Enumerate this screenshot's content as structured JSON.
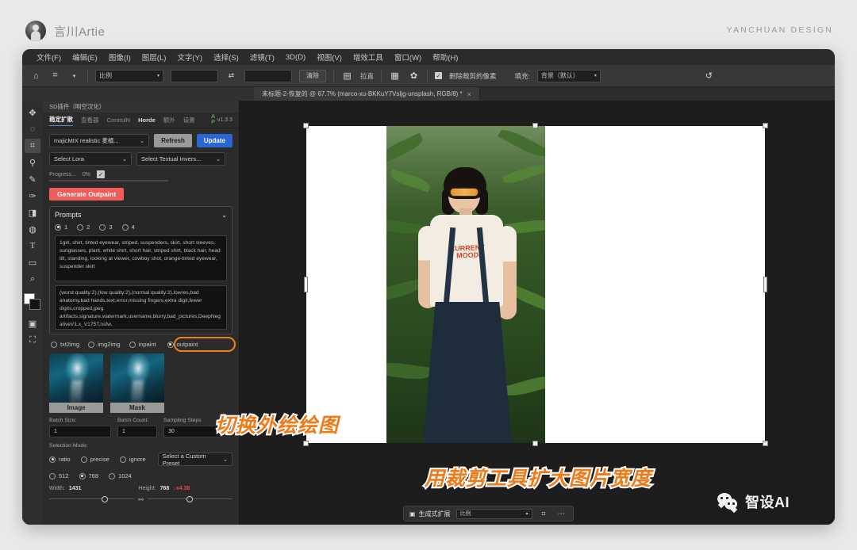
{
  "outer": {
    "author_name": "言川Artie",
    "brand_right": "YANCHUAN DESIGN"
  },
  "menubar": {
    "items": [
      "文件(F)",
      "编辑(E)",
      "图像(I)",
      "图层(L)",
      "文字(Y)",
      "选择(S)",
      "滤镜(T)",
      "3D(D)",
      "视图(V)",
      "增效工具",
      "窗口(W)",
      "帮助(H)"
    ]
  },
  "optionsbar": {
    "home_icon": "home-icon",
    "tool_icon": "crop-tool-icon",
    "ratio_select": "比例",
    "width_value": "",
    "height_value": "",
    "swap_icon": "swap-arrows-icon",
    "clear_button": "清除",
    "straighten_label": "拉直",
    "straighten_icon": "straighten-icon",
    "grid_icon": "grid-overlay-icon",
    "gear_icon": "gear-icon",
    "delete_cropped_label": "删除裁剪的像素",
    "fill_label": "填充:",
    "fill_value": "背景（默认）",
    "reset_icon": "reset-icon"
  },
  "tabstrip": {
    "doc_tab_title": "未标题-2-恢复的 @ 67.7% (marco-xu-BKKuY7Vsljg-unsplash, RGB/8) *",
    "close_icon": "close-icon"
  },
  "tools": {
    "items": [
      {
        "name": "move-tool",
        "glyph": "✥"
      },
      {
        "name": "lasso-tool",
        "glyph": "◯"
      },
      {
        "name": "crop-tool",
        "glyph": "⌗",
        "active": true
      },
      {
        "name": "eyedropper-tool",
        "glyph": "⚲"
      },
      {
        "name": "brush-tool",
        "glyph": "✎"
      },
      {
        "name": "healing-brush-tool",
        "glyph": "✒"
      },
      {
        "name": "paint-bucket-tool",
        "glyph": "◨"
      },
      {
        "name": "dodge-tool",
        "glyph": "⌕"
      },
      {
        "name": "type-tool",
        "glyph": "T"
      },
      {
        "name": "shape-tool",
        "glyph": "▭"
      },
      {
        "name": "zoom-tool",
        "glyph": "🔍"
      }
    ]
  },
  "sdpanel": {
    "title": "SD插件（明空汉化）",
    "tabs": [
      {
        "label": "稳定扩散",
        "active": true
      },
      {
        "label": "查看器",
        "active": false
      },
      {
        "label": "ControlN",
        "active": false
      },
      {
        "label": "Horde",
        "active": false
      },
      {
        "label": "额外",
        "active": false
      },
      {
        "label": "设置",
        "active": false
      }
    ],
    "version": "v1.3.3",
    "model_select": "majicMIX realistic 麦橘...",
    "refresh_button": "Refresh",
    "update_button": "Update",
    "lora_select": "Select Lora",
    "textual_inversion_select": "Select Textual Invers...",
    "progress_label": "Progress...",
    "progress_value": "0%",
    "generate_button": "Generate Outpaint",
    "prompts": {
      "header": "Prompts",
      "collapse_icon": "chevron-down-icon",
      "slots": [
        "1",
        "2",
        "3",
        "4"
      ],
      "selected_slot": "1",
      "positive": "1girl, shirt, tinted eyewear, striped, suspenders, skirt, short sleeves, sunglasses, plant, white shirt, short hair, striped shirt, black hair, head tilt, standing, looking at viewer, cowboy shot, orange-tinted eyewear, suspender skirt",
      "negative": "(worst quality:2),(low quality:2),(normal quality:2),lowres,bad anatomy,bad hands,text,error,missing fingers,extra digit,fewer digits,cropped,jpeg artifacts,signature,watermark,username,blurry,bad_pictures,DeepNegativeV1.x_V175T,nsfw,"
    },
    "modes": [
      {
        "label": "txt2img",
        "selected": false
      },
      {
        "label": "img2img",
        "selected": false
      },
      {
        "label": "inpaint",
        "selected": false
      },
      {
        "label": "outpaint",
        "selected": true
      }
    ],
    "thumbnails": [
      {
        "caption": "Image"
      },
      {
        "caption": "Mask"
      }
    ],
    "batch_size_label": "Batch Size:",
    "batch_size_value": "1",
    "batch_count_label": "Batch Count:",
    "batch_count_value": "1",
    "sampling_steps_label": "Sampling Steps",
    "sampling_steps_value": "30",
    "selection_mode_label": "Selection Mode:",
    "selection_modes": [
      {
        "label": "ratio",
        "selected": true
      },
      {
        "label": "precise",
        "selected": false
      },
      {
        "label": "ignore",
        "selected": false
      }
    ],
    "custom_preset_select": "Select a Custom Preset",
    "size_presets": [
      {
        "label": "512",
        "selected": false
      },
      {
        "label": "768",
        "selected": true
      },
      {
        "label": "1024",
        "selected": false
      }
    ],
    "width_label": "Width:",
    "width_value": "1431",
    "height_label": "Height:",
    "height_value": "768",
    "scale_warning": "↓x4.38",
    "link_icon": "link-icon"
  },
  "annotations": {
    "switch_outpaint": "切换外绘绘图",
    "expand_width": "用裁剪工具扩大图片宽度",
    "accent_color": "#f07a17"
  },
  "canvas": {
    "shirt_text_line1": "CURRENT",
    "shirt_text_line2": "MOOD"
  },
  "bottombar": {
    "generative_expand_icon": "generative-expand-icon",
    "generative_expand_label": "生成式扩展",
    "ratio_select": "比例",
    "crop_icon": "crop-icon",
    "more_icon": "more-options-icon"
  },
  "wechat": {
    "icon": "wechat-icon",
    "label": "智设AI"
  }
}
